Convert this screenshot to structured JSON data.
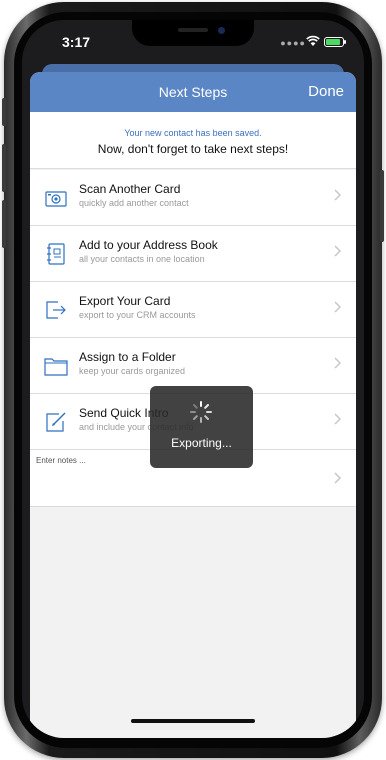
{
  "status_bar": {
    "time": "3:17"
  },
  "nav": {
    "title": "Next Steps",
    "done_label": "Done"
  },
  "banner": {
    "line1": "Your new contact has been saved.",
    "line2": "Now, don't forget to take next steps!"
  },
  "items": [
    {
      "title": "Scan Another Card",
      "subtitle": "quickly add another contact",
      "icon": "camera-icon"
    },
    {
      "title": "Add to your Address Book",
      "subtitle": "all your contacts in one location",
      "icon": "address-book-icon"
    },
    {
      "title": "Export Your Card",
      "subtitle": "export to your CRM accounts",
      "icon": "export-icon"
    },
    {
      "title": "Assign to a Folder",
      "subtitle": "keep your cards organized",
      "icon": "folder-icon"
    },
    {
      "title": "Send Quick Intro",
      "subtitle": "and include your contact info",
      "icon": "compose-icon"
    }
  ],
  "notes": {
    "placeholder": "Enter notes ..."
  },
  "toast": {
    "text": "Exporting..."
  },
  "colors": {
    "accent": "#5b86c5",
    "link_blue": "#3a70c0",
    "chevron": "#c7c7cc"
  }
}
